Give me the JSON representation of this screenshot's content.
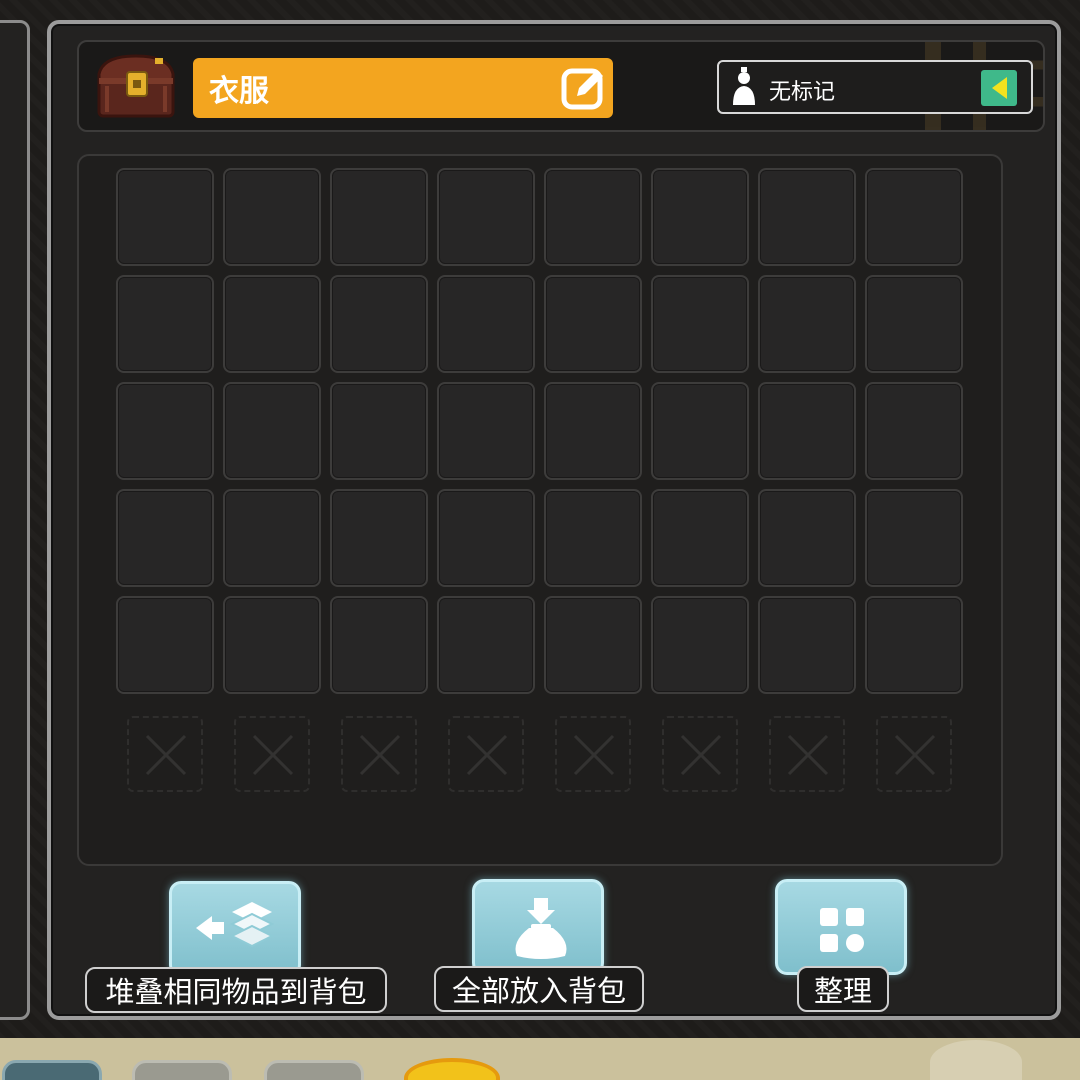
{
  "storage": {
    "name": "衣服",
    "mark_label": "无标记"
  },
  "grid": {
    "columns": 8,
    "unlocked_rows": 5,
    "locked_slots": 8
  },
  "actions": [
    {
      "label": "堆叠相同物品到背包",
      "icon": "stack-to-bag-icon"
    },
    {
      "label": "全部放入背包",
      "icon": "deposit-all-icon"
    },
    {
      "label": "整理",
      "icon": "sort-grid-icon"
    }
  ],
  "colors": {
    "name_box": "#f3a51f",
    "button": "#8fcbd6",
    "mark_arrow": "#3fb98a"
  }
}
